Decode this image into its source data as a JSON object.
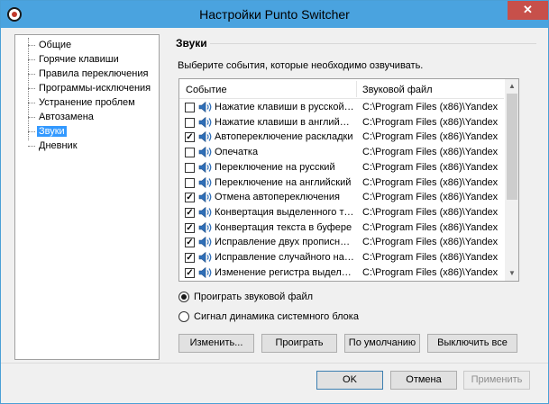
{
  "window": {
    "title": "Настройки Punto Switcher",
    "close_glyph": "✕"
  },
  "sidebar": {
    "items": [
      {
        "label": "Общие",
        "selected": false
      },
      {
        "label": "Горячие клавиши",
        "selected": false
      },
      {
        "label": "Правила переключения",
        "selected": false
      },
      {
        "label": "Программы-исключения",
        "selected": false
      },
      {
        "label": "Устранение проблем",
        "selected": false
      },
      {
        "label": "Автозамена",
        "selected": false
      },
      {
        "label": "Звуки",
        "selected": true
      },
      {
        "label": "Дневник",
        "selected": false
      }
    ]
  },
  "section": {
    "title": "Звуки",
    "instruction": "Выберите события, которые необходимо озвучивать."
  },
  "table": {
    "columns": {
      "event": "Событие",
      "file": "Звуковой файл"
    },
    "rows": [
      {
        "checked": false,
        "event": "Нажатие клавиши в русской раскладке",
        "file": "C:\\Program Files (x86)\\Yandex"
      },
      {
        "checked": false,
        "event": "Нажатие клавиши в английской раскладке",
        "file": "C:\\Program Files (x86)\\Yandex"
      },
      {
        "checked": true,
        "event": "Автопереключение раскладки",
        "file": "C:\\Program Files (x86)\\Yandex"
      },
      {
        "checked": false,
        "event": "Опечатка",
        "file": "C:\\Program Files (x86)\\Yandex"
      },
      {
        "checked": false,
        "event": "Переключение на русский",
        "file": "C:\\Program Files (x86)\\Yandex"
      },
      {
        "checked": false,
        "event": "Переключение на английский",
        "file": "C:\\Program Files (x86)\\Yandex"
      },
      {
        "checked": true,
        "event": "Отмена автопереключения",
        "file": "C:\\Program Files (x86)\\Yandex"
      },
      {
        "checked": true,
        "event": "Конвертация выделенного текста",
        "file": "C:\\Program Files (x86)\\Yandex"
      },
      {
        "checked": true,
        "event": "Конвертация текста в буфере",
        "file": "C:\\Program Files (x86)\\Yandex"
      },
      {
        "checked": true,
        "event": "Исправление двух прописных букв",
        "file": "C:\\Program Files (x86)\\Yandex"
      },
      {
        "checked": true,
        "event": "Исправление случайного нажатия",
        "file": "C:\\Program Files (x86)\\Yandex"
      },
      {
        "checked": true,
        "event": "Изменение регистра выделенного",
        "file": "C:\\Program Files (x86)\\Yandex"
      }
    ],
    "check_glyph": "✓",
    "scroll_up_glyph": "▲",
    "scroll_down_glyph": "▼"
  },
  "radios": {
    "play_file": {
      "label": "Проиграть звуковой файл",
      "checked": true
    },
    "system_beep": {
      "label": "Сигнал динамика системного блока",
      "checked": false
    }
  },
  "buttons": {
    "change": "Изменить...",
    "play": "Проиграть",
    "default": "По умолчанию",
    "disable_all": "Выключить все",
    "ok": "OK",
    "cancel": "Отмена",
    "apply": "Применить"
  },
  "icons": {
    "window": "punto-switcher-icon",
    "row": "speaker-icon",
    "close": "close-icon"
  },
  "colors": {
    "titlebar": "#4aa3df",
    "close": "#c7504a",
    "selection": "#3399ff",
    "speaker": "#2f6fb8"
  }
}
